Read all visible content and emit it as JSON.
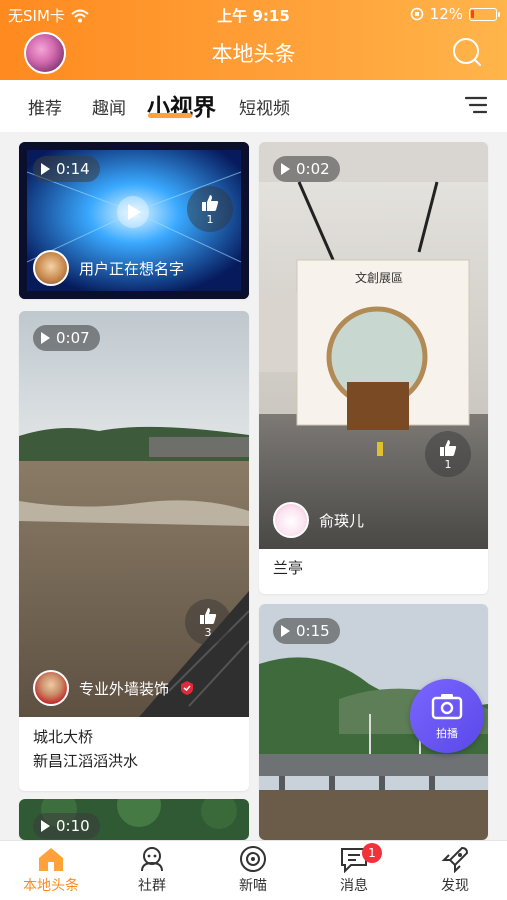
{
  "status_bar": {
    "carrier": "无SIM卡",
    "time": "上午 9:15",
    "battery_percent": "12%",
    "battery_level": 0.12
  },
  "header": {
    "title": "本地头条",
    "search_icon": "search-icon",
    "accent": "#ff8a1f"
  },
  "tabs": [
    {
      "label": "推荐"
    },
    {
      "label": "趣闻"
    },
    {
      "label": "小视界",
      "active": true
    },
    {
      "label": "短视频"
    }
  ],
  "feed": [
    {
      "duration": "0:14",
      "likes": "1",
      "user": "用户正在想名字"
    },
    {
      "duration": "0:02",
      "likes": "1",
      "user": "俞瑛儿",
      "caption": "兰亭",
      "sign_text": "文創展區"
    },
    {
      "duration": "0:07",
      "likes": "3",
      "user": "专业外墙装饰",
      "caption": "城北大桥\n新昌江滔滔洪水"
    },
    {
      "duration": "0:15"
    },
    {
      "duration": "0:10"
    }
  ],
  "camera_button": {
    "label": "拍播"
  },
  "bottom_nav": [
    {
      "label": "本地头条",
      "icon": "home-icon",
      "active": true
    },
    {
      "label": "社群",
      "icon": "community-icon"
    },
    {
      "label": "新喵",
      "icon": "cat-eye-icon"
    },
    {
      "label": "消息",
      "icon": "message-icon",
      "badge": "1"
    },
    {
      "label": "发现",
      "icon": "rocket-icon"
    }
  ]
}
